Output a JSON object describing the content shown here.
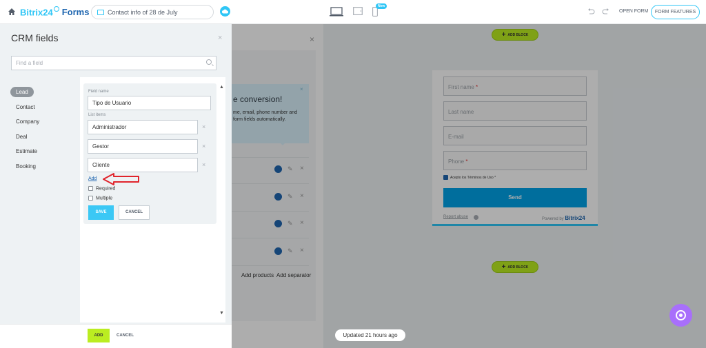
{
  "header": {
    "brand_b24": "Bitrix24",
    "brand_forms": "Forms",
    "form_title": "Contact info of 28 de July",
    "new_badge": "New",
    "open_form": "OPEN FORM",
    "form_features": "FORM FEATURES"
  },
  "background": {
    "tip_title": "e conversion!",
    "tip_text": "me, email, phone number and form fields automatically.",
    "add_products": "Add products",
    "add_separator": "Add separator",
    "add_block_top": "ADD BLOCK",
    "add_block_bottom": "ADD BLOCK",
    "preview_form": {
      "first_name": "First name",
      "last_name": "Last name",
      "email": "E-mail",
      "phone": "Phone",
      "required_mark": "*",
      "consent": "Acepto los Términos de Uso",
      "send": "Send",
      "report_abuse": "Report abuse",
      "powered_by": "Powered by",
      "powered_brand": "Bitrix24"
    },
    "updated": "Updated 21 hours ago"
  },
  "crm_panel": {
    "title": "CRM fields",
    "search_placeholder": "Find a field",
    "categories": [
      "Lead",
      "Contact",
      "Company",
      "Deal",
      "Estimate",
      "Booking"
    ],
    "active_category": "Lead",
    "editor": {
      "field_name_label": "Field name",
      "field_name_value": "Tipo de Usuario",
      "list_items_label": "List items",
      "list_items": [
        "Administrador",
        "Gestor",
        "Cliente"
      ],
      "add_link": "Add",
      "required_label": "Required",
      "multiple_label": "Multiple",
      "save": "SAVE",
      "cancel": "CANCEL"
    },
    "footer": {
      "add": "ADD",
      "cancel": "CANCEL"
    }
  },
  "colors": {
    "accent": "#2fc6f6",
    "brand_blue": "#2067b0",
    "add_green": "#bbed21",
    "annotation_red": "#e0242c"
  }
}
